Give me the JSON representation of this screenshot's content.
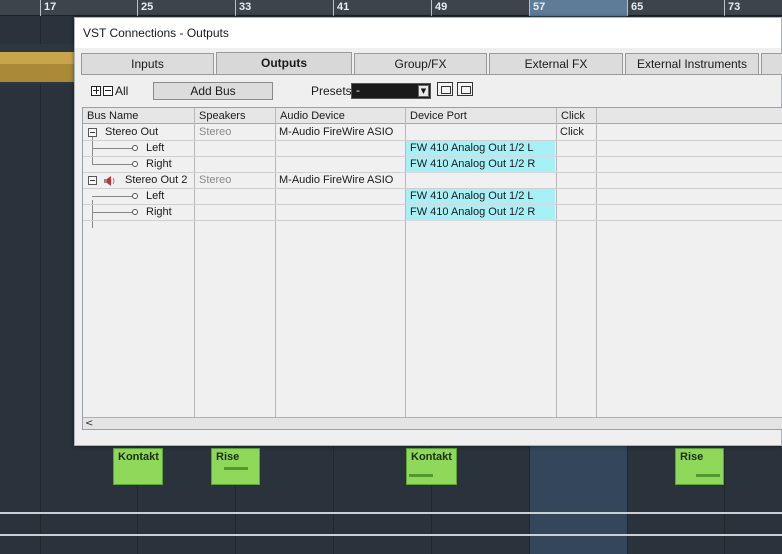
{
  "ruler": {
    "marks": [
      "17",
      "25",
      "33",
      "41",
      "49",
      "57",
      "65",
      "73"
    ]
  },
  "arrangement": {
    "parts": [
      {
        "label": "Kontakt"
      },
      {
        "label": "Rise"
      },
      {
        "label": "Kontakt"
      },
      {
        "label": "Rise"
      }
    ]
  },
  "window": {
    "title": "VST Connections - Outputs",
    "tabs": [
      "Inputs",
      "Outputs",
      "Group/FX",
      "External FX",
      "External Instruments"
    ],
    "active_tab": "Outputs",
    "toolbar": {
      "all_label": "All",
      "add_bus_label": "Add Bus",
      "presets_label": "Presets",
      "presets_value": "-"
    },
    "table": {
      "columns": [
        "Bus Name",
        "Speakers",
        "Audio Device",
        "Device Port",
        "Click"
      ],
      "rows": [
        {
          "bus": "Stereo Out",
          "speakers": "Stereo",
          "device": "M-Audio FireWire ASIO",
          "port": "",
          "click": "Click"
        },
        {
          "bus": "Left",
          "speakers": "",
          "device": "",
          "port": "FW 410 Analog Out 1/2 L",
          "click": ""
        },
        {
          "bus": "Right",
          "speakers": "",
          "device": "",
          "port": "FW 410 Analog Out 1/2 R",
          "click": ""
        },
        {
          "bus": "Stereo Out 2",
          "speakers": "Stereo",
          "device": "M-Audio FireWire ASIO",
          "port": "",
          "click": ""
        },
        {
          "bus": "Left",
          "speakers": "",
          "device": "",
          "port": "FW 410 Analog Out 1/2 L",
          "click": ""
        },
        {
          "bus": "Right",
          "speakers": "",
          "device": "",
          "port": "FW 410 Analog Out 1/2 R",
          "click": ""
        }
      ]
    }
  },
  "colors": {
    "port_highlight": "#a8f0f8",
    "part_green": "#8fd85a",
    "loop_range": "#33465a"
  }
}
